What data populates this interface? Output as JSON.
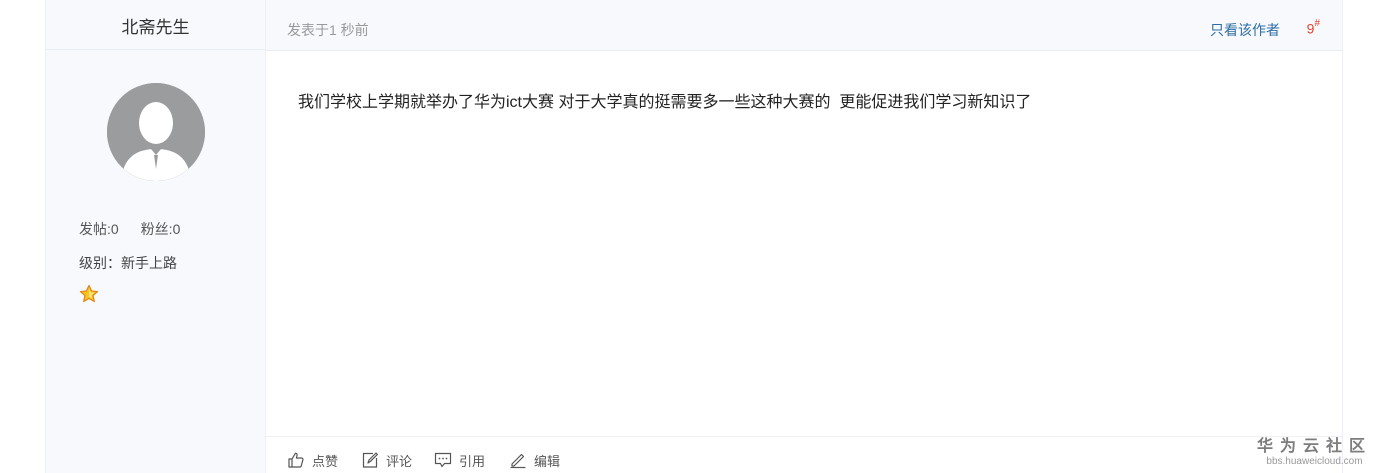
{
  "author": {
    "name": "北斋先生",
    "posts_label": "发帖:0",
    "fans_label": "粉丝:0",
    "level_label": "级别：新手上路"
  },
  "post": {
    "time": "发表于1 秒前",
    "only_author": "只看该作者",
    "floor": "9",
    "floor_mark": "#",
    "content": "我们学校上学期就举办了华为ict大赛 对于大学真的挺需要多一些这种大赛的  更能促进我们学习新知识了"
  },
  "actions": {
    "like": "点赞",
    "comment": "评论",
    "quote": "引用",
    "edit": "编辑"
  },
  "watermark": {
    "title": "华为云社区",
    "url": "bbs.huaweicloud.com"
  },
  "colors": {
    "link_blue": "#2e6da4",
    "floor_red": "#e2452e",
    "panel_bg": "#f7f9fd"
  },
  "icons": [
    "avatar-placeholder",
    "star-icon",
    "thumbs-up-icon",
    "comment-icon",
    "quote-icon",
    "edit-icon"
  ]
}
